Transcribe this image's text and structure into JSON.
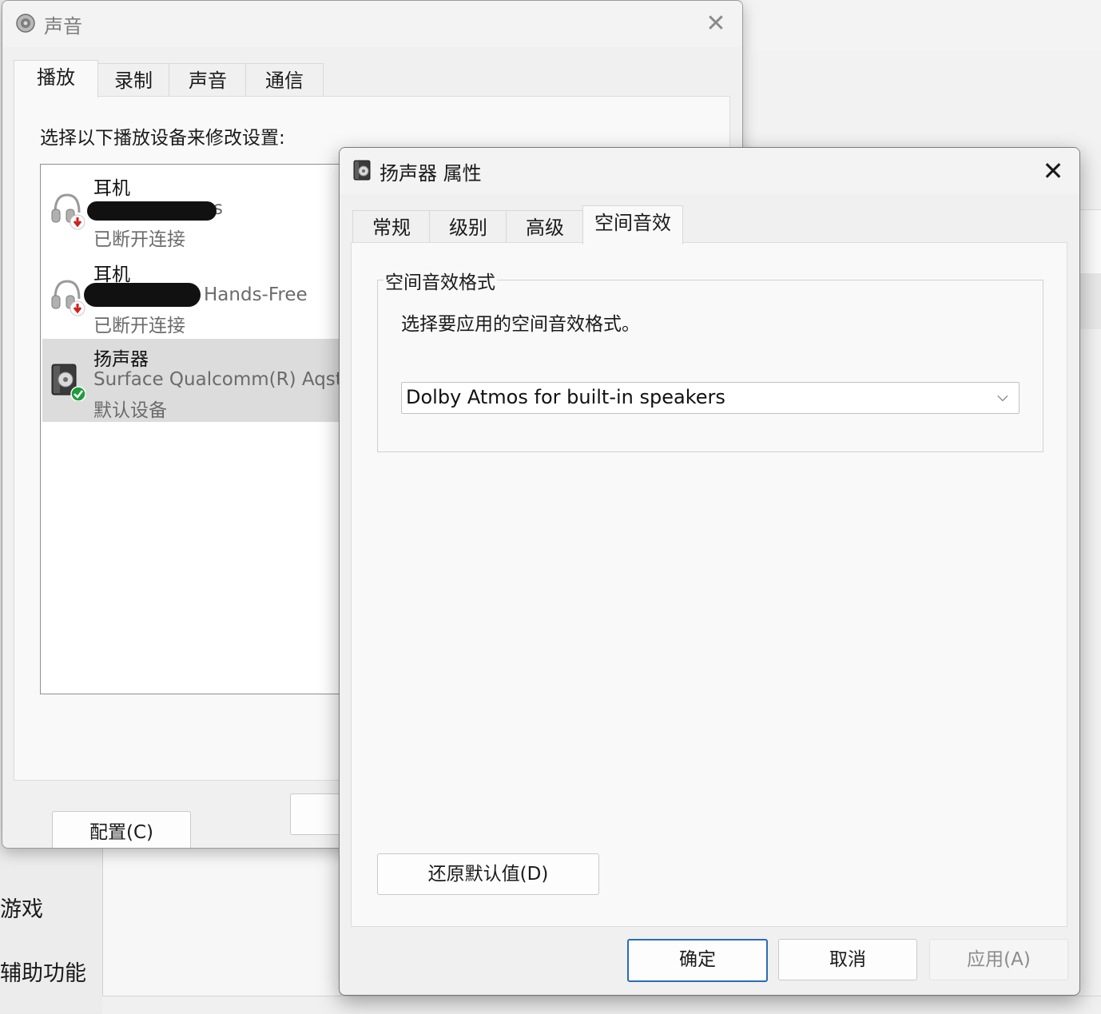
{
  "background_app": {
    "nav_items": [
      "游戏",
      "辅助功能"
    ]
  },
  "sound_dialog": {
    "title": "声音",
    "tabs": [
      {
        "label": "播放",
        "active": true
      },
      {
        "label": "录制",
        "active": false
      },
      {
        "label": "声音",
        "active": false
      },
      {
        "label": "通信",
        "active": false
      }
    ],
    "instruction": "选择以下播放设备来修改设置:",
    "devices": [
      {
        "name": "耳机",
        "description": "s",
        "status": "已断开连接",
        "icon": "headphones-icon",
        "status_icon": "disconnected-arrow-icon",
        "selected": false
      },
      {
        "name": "耳机",
        "description": "Hands-Free",
        "status": "已断开连接",
        "icon": "headphones-icon",
        "status_icon": "disconnected-arrow-icon",
        "selected": false
      },
      {
        "name": "扬声器",
        "description": "Surface Qualcomm(R) Aqst",
        "status": "默认设备",
        "icon": "speaker-icon",
        "status_icon": "default-check-icon",
        "selected": true
      }
    ],
    "configure_button": "配置(C)"
  },
  "properties_dialog": {
    "title": "扬声器 属性",
    "tabs": [
      {
        "label": "常规",
        "active": false
      },
      {
        "label": "级别",
        "active": false
      },
      {
        "label": "高级",
        "active": false
      },
      {
        "label": "空间音效",
        "active": true
      }
    ],
    "group_title": "空间音效格式",
    "group_description": "选择要应用的空间音效格式。",
    "format_select_value": "Dolby Atmos for built-in speakers",
    "restore_button": "还原默认值(D)",
    "ok_button": "确定",
    "cancel_button": "取消",
    "apply_button": "应用(A)"
  },
  "colors": {
    "default_button_border": "#2b6cb5",
    "status_check": "#1e9c3c",
    "status_disconnected": "#d0201c"
  }
}
